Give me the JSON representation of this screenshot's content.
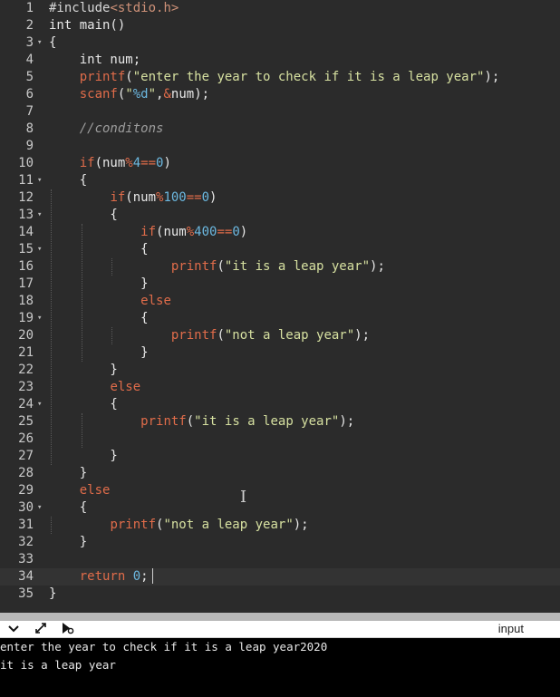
{
  "editor": {
    "lines": [
      {
        "n": "1",
        "fold": false,
        "tokens": [
          [
            "t-pp",
            "#include"
          ],
          [
            "t-pps",
            "<stdio.h>"
          ]
        ]
      },
      {
        "n": "2",
        "fold": false,
        "tokens": [
          [
            "t-kw3",
            "int main()"
          ]
        ]
      },
      {
        "n": "3",
        "fold": true,
        "tokens": [
          [
            "t-pl",
            "{"
          ]
        ]
      },
      {
        "n": "4",
        "fold": false,
        "tokens": [
          [
            "t-pl",
            "    int num;"
          ]
        ]
      },
      {
        "n": "5",
        "fold": false,
        "tokens": [
          [
            "t-pl",
            "    "
          ],
          [
            "t-fn",
            "printf"
          ],
          [
            "t-pl",
            "("
          ],
          [
            "t-str",
            "\"enter the year to check if it is a leap year\""
          ],
          [
            "t-pl",
            ");"
          ]
        ]
      },
      {
        "n": "6",
        "fold": false,
        "tokens": [
          [
            "t-pl",
            "    "
          ],
          [
            "t-fn",
            "scanf"
          ],
          [
            "t-pl",
            "("
          ],
          [
            "t-str",
            "\""
          ],
          [
            "t-num",
            "%d"
          ],
          [
            "t-str",
            "\""
          ],
          [
            "t-pl",
            ","
          ],
          [
            "t-op",
            "&"
          ],
          [
            "t-pl",
            "num);"
          ]
        ]
      },
      {
        "n": "7",
        "fold": false,
        "tokens": []
      },
      {
        "n": "8",
        "fold": false,
        "tokens": [
          [
            "t-pl",
            "    "
          ],
          [
            "t-cm",
            "//conditons"
          ]
        ]
      },
      {
        "n": "9",
        "fold": false,
        "tokens": []
      },
      {
        "n": "10",
        "fold": false,
        "tokens": [
          [
            "t-pl",
            "    "
          ],
          [
            "t-kw2",
            "if"
          ],
          [
            "t-pl",
            "(num"
          ],
          [
            "t-op",
            "%"
          ],
          [
            "t-num",
            "4"
          ],
          [
            "t-op",
            "=="
          ],
          [
            "t-num",
            "0"
          ],
          [
            "t-pl",
            ")"
          ]
        ]
      },
      {
        "n": "11",
        "fold": true,
        "tokens": [
          [
            "t-pl",
            "    {"
          ]
        ]
      },
      {
        "n": "12",
        "fold": false,
        "tokens": [
          [
            "t-pl",
            "        "
          ],
          [
            "t-kw2",
            "if"
          ],
          [
            "t-pl",
            "(num"
          ],
          [
            "t-op",
            "%"
          ],
          [
            "t-num",
            "100"
          ],
          [
            "t-op",
            "=="
          ],
          [
            "t-num",
            "0"
          ],
          [
            "t-pl",
            ")"
          ]
        ]
      },
      {
        "n": "13",
        "fold": true,
        "tokens": [
          [
            "t-pl",
            "        {"
          ]
        ]
      },
      {
        "n": "14",
        "fold": false,
        "tokens": [
          [
            "t-pl",
            "            "
          ],
          [
            "t-kw2",
            "if"
          ],
          [
            "t-pl",
            "(num"
          ],
          [
            "t-op",
            "%"
          ],
          [
            "t-num",
            "400"
          ],
          [
            "t-op",
            "=="
          ],
          [
            "t-num",
            "0"
          ],
          [
            "t-pl",
            ")"
          ]
        ]
      },
      {
        "n": "15",
        "fold": true,
        "tokens": [
          [
            "t-pl",
            "            {"
          ]
        ]
      },
      {
        "n": "16",
        "fold": false,
        "tokens": [
          [
            "t-pl",
            "                "
          ],
          [
            "t-fn",
            "printf"
          ],
          [
            "t-pl",
            "("
          ],
          [
            "t-str",
            "\"it is a leap year\""
          ],
          [
            "t-pl",
            ");"
          ]
        ]
      },
      {
        "n": "17",
        "fold": false,
        "tokens": [
          [
            "t-pl",
            "            }"
          ]
        ]
      },
      {
        "n": "18",
        "fold": false,
        "tokens": [
          [
            "t-pl",
            "            "
          ],
          [
            "t-kw2",
            "else"
          ]
        ]
      },
      {
        "n": "19",
        "fold": true,
        "tokens": [
          [
            "t-pl",
            "            {"
          ]
        ]
      },
      {
        "n": "20",
        "fold": false,
        "tokens": [
          [
            "t-pl",
            "                "
          ],
          [
            "t-fn",
            "printf"
          ],
          [
            "t-pl",
            "("
          ],
          [
            "t-str",
            "\"not a leap year\""
          ],
          [
            "t-pl",
            ");"
          ]
        ]
      },
      {
        "n": "21",
        "fold": false,
        "tokens": [
          [
            "t-pl",
            "            }"
          ]
        ]
      },
      {
        "n": "22",
        "fold": false,
        "tokens": [
          [
            "t-pl",
            "        }"
          ]
        ]
      },
      {
        "n": "23",
        "fold": false,
        "tokens": [
          [
            "t-pl",
            "        "
          ],
          [
            "t-kw2",
            "else"
          ]
        ]
      },
      {
        "n": "24",
        "fold": true,
        "tokens": [
          [
            "t-pl",
            "        {"
          ]
        ]
      },
      {
        "n": "25",
        "fold": false,
        "tokens": [
          [
            "t-pl",
            "            "
          ],
          [
            "t-fn",
            "printf"
          ],
          [
            "t-pl",
            "("
          ],
          [
            "t-str",
            "\"it is a leap year\""
          ],
          [
            "t-pl",
            ");"
          ]
        ]
      },
      {
        "n": "26",
        "fold": false,
        "tokens": []
      },
      {
        "n": "27",
        "fold": false,
        "tokens": [
          [
            "t-pl",
            "        }"
          ]
        ]
      },
      {
        "n": "28",
        "fold": false,
        "tokens": [
          [
            "t-pl",
            "    }"
          ]
        ]
      },
      {
        "n": "29",
        "fold": false,
        "tokens": [
          [
            "t-pl",
            "    "
          ],
          [
            "t-kw2",
            "else"
          ]
        ]
      },
      {
        "n": "30",
        "fold": true,
        "tokens": [
          [
            "t-pl",
            "    {"
          ]
        ]
      },
      {
        "n": "31",
        "fold": false,
        "tokens": [
          [
            "t-pl",
            "        "
          ],
          [
            "t-fn",
            "printf"
          ],
          [
            "t-pl",
            "("
          ],
          [
            "t-str",
            "\"not a leap year\""
          ],
          [
            "t-pl",
            ");"
          ]
        ]
      },
      {
        "n": "32",
        "fold": false,
        "tokens": [
          [
            "t-pl",
            "    }"
          ]
        ]
      },
      {
        "n": "33",
        "fold": false,
        "tokens": []
      },
      {
        "n": "34",
        "fold": false,
        "active": true,
        "tokens": [
          [
            "t-pl",
            "    "
          ],
          [
            "t-ret",
            "return"
          ],
          [
            "t-pl",
            " "
          ],
          [
            "t-num",
            "0"
          ],
          [
            "t-pl",
            ";"
          ]
        ]
      },
      {
        "n": "35",
        "fold": false,
        "tokens": [
          [
            "t-pl",
            "}"
          ]
        ]
      }
    ]
  },
  "toolbar": {
    "icons": [
      "chevron-down-icon",
      "expand-icon",
      "settings-run-icon"
    ],
    "input_label": "input"
  },
  "console": {
    "output": [
      "enter the year to check if it is a leap year2020",
      "it is a leap year"
    ]
  }
}
